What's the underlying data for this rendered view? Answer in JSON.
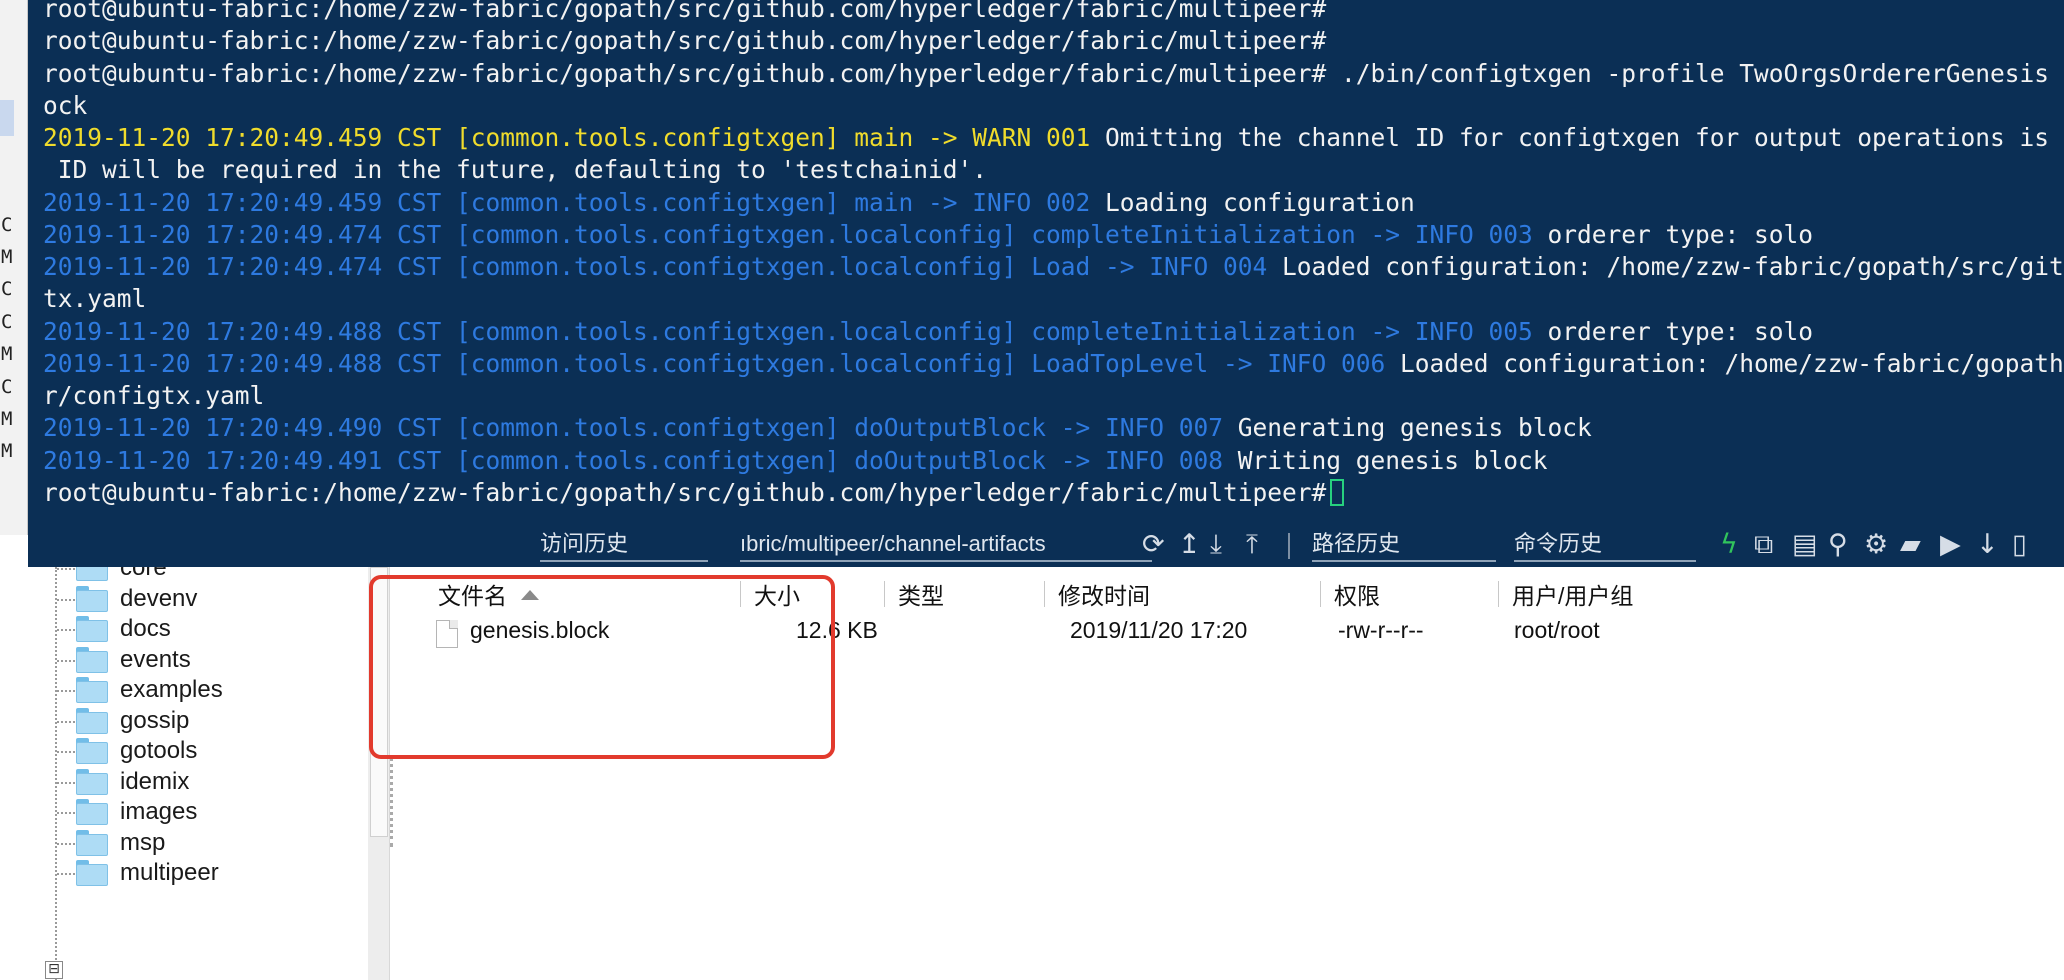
{
  "left_strip": {
    "chars": [
      "C",
      "M",
      "C",
      "C",
      "M",
      "C",
      "M",
      "M"
    ]
  },
  "terminal": {
    "lines": [
      {
        "segments": [
          {
            "text": "root@ubuntu-fabric:/home/zzw-fabric/gopath/src/github.com/hyperledger/fabric/multipeer#",
            "color": "w"
          }
        ]
      },
      {
        "segments": [
          {
            "text": "root@ubuntu-fabric:/home/zzw-fabric/gopath/src/github.com/hyperledger/fabric/multipeer#",
            "color": "w"
          }
        ]
      },
      {
        "segments": [
          {
            "text": "root@ubuntu-fabric:/home/zzw-fabric/gopath/src/github.com/hyperledger/fabric/multipeer# ./bin/configtxgen -profile TwoOrgsOrdererGenesis -outputB",
            "color": "w"
          }
        ]
      },
      {
        "segments": [
          {
            "text": "ock",
            "color": "w"
          }
        ]
      },
      {
        "segments": [
          {
            "text": "2019-11-20 17:20:49.459 CST [common.tools.configtxgen] main -> WARN 001",
            "color": "y"
          },
          {
            "text": " Omitting the channel ID for configtxgen for output operations is depreca",
            "color": "w"
          }
        ]
      },
      {
        "segments": [
          {
            "text": " ID will be required in the future, defaulting to 'testchainid'.",
            "color": "w"
          }
        ]
      },
      {
        "segments": [
          {
            "text": "2019-11-20 17:20:49.459 CST [common.tools.configtxgen] main -> INFO 002",
            "color": "b"
          },
          {
            "text": " Loading configuration",
            "color": "w"
          }
        ]
      },
      {
        "segments": [
          {
            "text": "2019-11-20 17:20:49.474 CST [common.tools.configtxgen.localconfig] completeInitialization -> INFO 003",
            "color": "b"
          },
          {
            "text": " orderer type: solo",
            "color": "w"
          }
        ]
      },
      {
        "segments": [
          {
            "text": "2019-11-20 17:20:49.474 CST [common.tools.configtxgen.localconfig] Load -> INFO 004",
            "color": "b"
          },
          {
            "text": " Loaded configuration: /home/zzw-fabric/gopath/src/github.com/",
            "color": "w"
          }
        ]
      },
      {
        "segments": [
          {
            "text": "tx.yaml",
            "color": "w"
          }
        ]
      },
      {
        "segments": [
          {
            "text": "2019-11-20 17:20:49.488 CST [common.tools.configtxgen.localconfig] completeInitialization -> INFO 005",
            "color": "b"
          },
          {
            "text": " orderer type: solo",
            "color": "w"
          }
        ]
      },
      {
        "segments": [
          {
            "text": "2019-11-20 17:20:49.488 CST [common.tools.configtxgen.localconfig] LoadTopLevel -> INFO 006",
            "color": "b"
          },
          {
            "text": " Loaded configuration: /home/zzw-fabric/gopath/src/gi",
            "color": "w"
          }
        ]
      },
      {
        "segments": [
          {
            "text": "r/configtx.yaml",
            "color": "w"
          }
        ]
      },
      {
        "segments": [
          {
            "text": "2019-11-20 17:20:49.490 CST [common.tools.configtxgen] doOutputBlock -> INFO 007",
            "color": "b"
          },
          {
            "text": " Generating genesis block",
            "color": "w"
          }
        ]
      },
      {
        "segments": [
          {
            "text": "2019-11-20 17:20:49.491 CST [common.tools.configtxgen] doOutputBlock -> INFO 008",
            "color": "b"
          },
          {
            "text": " Writing genesis block",
            "color": "w"
          }
        ]
      },
      {
        "segments": [
          {
            "text": "root@ubuntu-fabric:/home/zzw-fabric/gopath/src/github.com/hyperledger/fabric/multipeer#",
            "color": "w"
          }
        ],
        "cursor": true
      }
    ]
  },
  "toolbar": {
    "history_placeholder": "访问历史",
    "path_value": "ıbric/multipeer/channel-artifacts",
    "path_history_placeholder": "路径历史",
    "command_history_placeholder": "命令历史"
  },
  "tree": {
    "items": [
      "core",
      "devenv",
      "docs",
      "events",
      "examples",
      "gossip",
      "gotools",
      "idemix",
      "images",
      "msp",
      "multipeer"
    ],
    "expander_symbol": "⊟"
  },
  "file_list": {
    "columns": [
      "文件名",
      "大小",
      "类型",
      "修改时间",
      "权限",
      "用户/用户组"
    ],
    "rows": [
      {
        "name": "genesis.block",
        "size": "12.6 KB",
        "type": "",
        "modified": "2019/11/20 17:20",
        "permissions": "-rw-r--r--",
        "owner": "root/root"
      }
    ]
  },
  "colors": {
    "terminal_bg": "#0b2f55",
    "log_blue": "#2e7ae0",
    "warn_yellow": "#f0dc2c",
    "cursor_green": "#27d07e",
    "highlight_red": "#e23a2d"
  }
}
